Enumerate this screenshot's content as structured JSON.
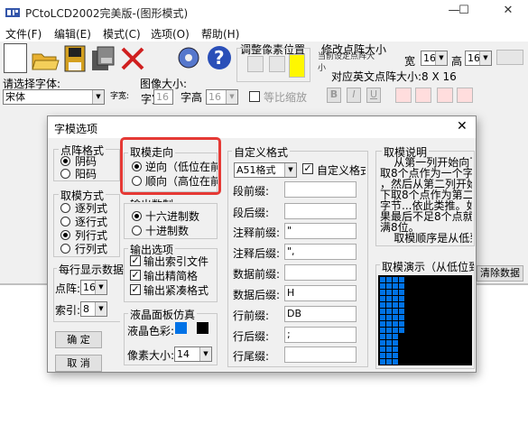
{
  "app": {
    "title": "PCtoLCD2002完美版-(图形模式)"
  },
  "menu": [
    "文件(F)",
    "编辑(E)",
    "模式(C)",
    "选项(O)",
    "帮助(H)"
  ],
  "toolbar": {
    "adjust_label": "调整像素位置",
    "modify_size_label": "修改点阵大小",
    "hint_text": "当前设定点阵大小",
    "width_label": "宽",
    "width_value": "16",
    "height_label": "高",
    "height_value": "16",
    "ascii_size_label": "对应英文点阵大小:8 X 16"
  },
  "fontbar": {
    "font_label": "请选择字体:",
    "font_value": "宋体",
    "image_size_label": "图像大小:",
    "char_width_label": "字宽",
    "char_width_value": "16",
    "char_height_label": "字高",
    "char_height_value": "16",
    "equal_scale_label": "等比缩放",
    "bold_label": "B",
    "italic_label": "I",
    "underline_label": "U"
  },
  "right_panel": {
    "clear_button": "清除数据"
  },
  "dialog": {
    "title": "字模选项",
    "dot_format": {
      "title": "点阵格式",
      "options": [
        "阴码",
        "阳码"
      ],
      "selected": 0
    },
    "mode": {
      "title": "取模方式",
      "options": [
        "逐列式",
        "逐行式",
        "列行式",
        "行列式"
      ],
      "selected": 2
    },
    "per_row": {
      "title": "每行显示数据",
      "points_label": "点阵:",
      "points_value": "16",
      "index_label": "索引:",
      "index_value": "8"
    },
    "direction": {
      "title": "取模走向",
      "options": [
        "逆向（低位在前",
        "顺向（高位在前"
      ],
      "selected": 0
    },
    "output_base": {
      "title": "输出数制",
      "options": [
        "十六进制数",
        "十进制数"
      ],
      "selected": 0
    },
    "output_options": {
      "title": "输出选项",
      "items": [
        "输出索引文件",
        "输出精简格",
        "输出紧凑格式"
      ],
      "checked": [
        true,
        true,
        true
      ]
    },
    "lcd_sim": {
      "title": "液晶面板仿真",
      "color_label": "液晶色彩:",
      "pixel_label": "像素大小:",
      "pixel_value": "14"
    },
    "custom": {
      "title": "自定义格式",
      "format_value": "A51格式",
      "custom_checkbox": "自定义格式",
      "fields": [
        {
          "label": "段前缀:",
          "value": ""
        },
        {
          "label": "段后缀:",
          "value": ""
        },
        {
          "label": "注释前缀:",
          "value": "\""
        },
        {
          "label": "注释后缀:",
          "value": "\","
        },
        {
          "label": "数据前缀:",
          "value": ""
        },
        {
          "label": "数据后缀:",
          "value": "H"
        },
        {
          "label": "行前缀:",
          "value": "DB"
        },
        {
          "label": "行后缀:",
          "value": ";"
        },
        {
          "label": "行尾缀:",
          "value": ""
        }
      ]
    },
    "explain": {
      "title": "取模说明",
      "text": "    从第一列开始向下\n取8个点作为一个字节\n，然后从第二列开始向\n下取8个点作为第二个\n字节...依此类推。如\n果最后不足8个点就补\n满8位。\n    取模顺序是从低到"
    },
    "demo": {
      "title": "取模演示（从低位到"
    },
    "ok_button": "确  定",
    "cancel_button": "取  消"
  },
  "colors": {
    "highlight": "#e53935",
    "lcd_on": "#0072e6",
    "lcd_bg": "#000000"
  }
}
